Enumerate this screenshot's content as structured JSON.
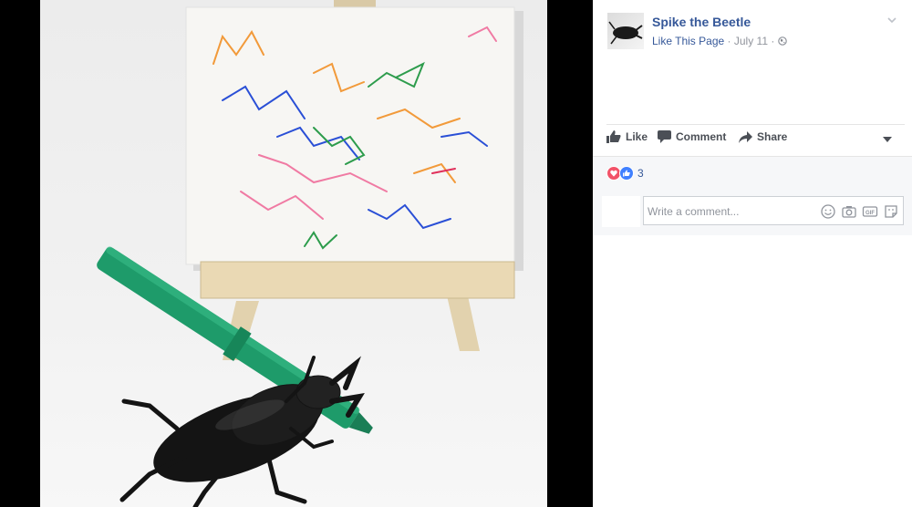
{
  "post": {
    "page_name": "Spike the Beetle",
    "like_page_label": "Like This Page",
    "date": "July 11",
    "separator": "·"
  },
  "actions": {
    "like": "Like",
    "comment": "Comment",
    "share": "Share"
  },
  "reactions": {
    "count": "3",
    "types": [
      "love",
      "like"
    ]
  },
  "comment_input": {
    "placeholder": "Write a comment..."
  },
  "comment_tools": [
    "emoji-icon",
    "camera-icon",
    "gif-icon",
    "sticker-icon"
  ],
  "colors": {
    "link": "#365899",
    "meta": "#90949c",
    "action_text": "#4b4f56",
    "love": "#f25268",
    "like": "#4080ff",
    "marker_green": "#1e9b6a"
  }
}
